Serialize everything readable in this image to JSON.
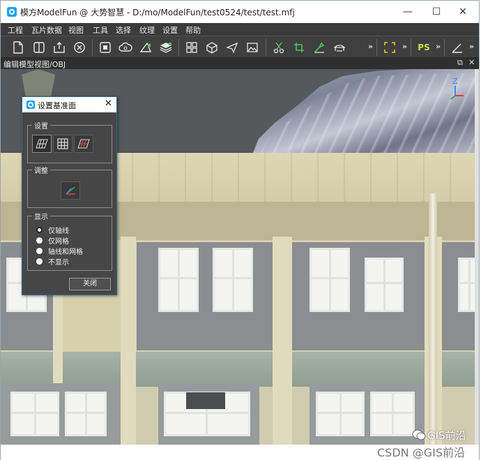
{
  "window": {
    "title": "模方ModelFun @ 大势智慧 - D:/mo/ModelFun/test0524/test/test.mfj",
    "controls": {
      "minimize": "—",
      "maximize": "☐",
      "close": "✕"
    }
  },
  "menu": [
    "工程",
    "瓦片数据",
    "视图",
    "工具",
    "选择",
    "纹理",
    "设置",
    "帮助"
  ],
  "toolbar": {
    "groups": [
      [
        "new-file-icon",
        "split-view-icon",
        "export-icon",
        "close-circle-icon"
      ],
      [
        "stop-icon",
        "cloud-icon",
        "shape-icon",
        "layers-icon"
      ],
      [
        "grid-view-icon",
        "cube-icon",
        "plane-icon",
        "image-icon"
      ],
      [
        "scissors-icon",
        "crop-icon",
        "repair-icon",
        "bridge-icon"
      ]
    ],
    "more": "»",
    "ps_label": "PS"
  },
  "viewtab": {
    "label": "编辑模型视图/OBJ",
    "restore": "⧉",
    "close": "✕"
  },
  "viewport": {
    "axis_label": "Z",
    "colors": {
      "sky": "#56595c",
      "facade": "#cfc8a6",
      "glass": "#f4f4f2"
    }
  },
  "dialog": {
    "title": "设置基准面",
    "close": "✕",
    "settings_group": "设置",
    "adjust_group": "调整",
    "display_group": "显示",
    "options": [
      {
        "label": "仅轴线",
        "checked": true
      },
      {
        "label": "仅网格",
        "checked": false
      },
      {
        "label": "轴线和网格",
        "checked": false
      },
      {
        "label": "不显示",
        "checked": false
      }
    ],
    "close_button": "关闭"
  },
  "watermark": {
    "line1": "GIS前沿",
    "line2": "CSDN @GIS前沿"
  }
}
